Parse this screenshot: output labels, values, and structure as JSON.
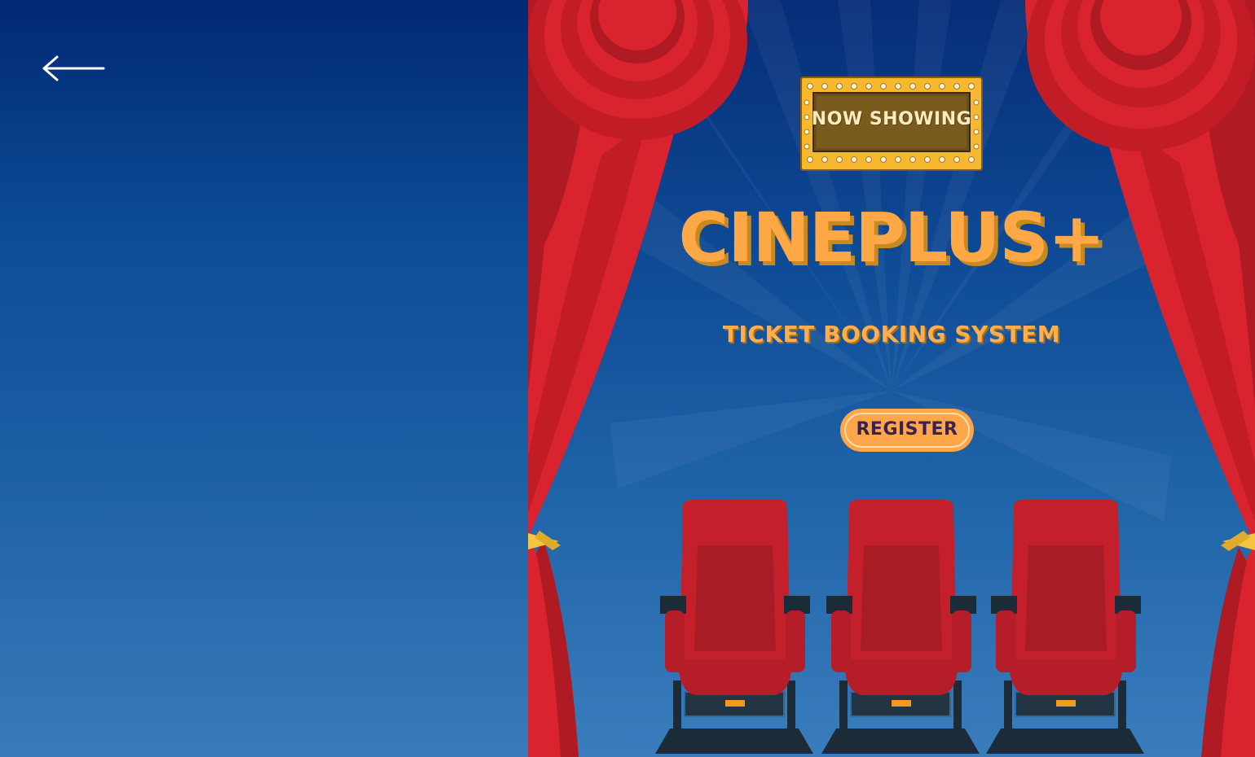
{
  "app": {
    "brand_title": "CINEPLUS+",
    "subtitle": "TICKET BOOKING SYSTEM",
    "marquee_text": "NOW SHOWING"
  },
  "navigation": {
    "back_icon": "arrow-left-icon"
  },
  "actions": {
    "register_label": "REGISTER"
  },
  "colors": {
    "left_panel_top": "#012873",
    "left_panel_bottom": "#3a7ab9",
    "accent_orange": "#ffa845",
    "curtain_red": "#d9232e",
    "marquee_gold": "#f5b82e",
    "seat_red": "#c4202b"
  },
  "decor": {
    "curtains": "red-curtain-icon",
    "seats": "cinema-seat-icon",
    "marquee": "marquee-sign-icon"
  }
}
